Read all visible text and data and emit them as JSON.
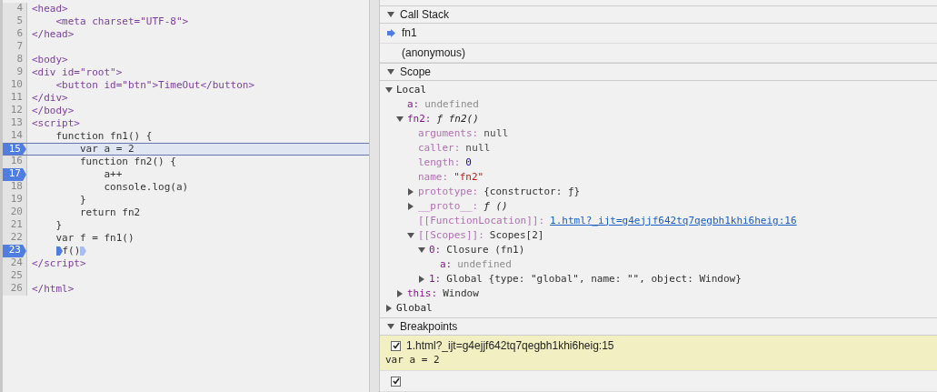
{
  "editor": {
    "lines": [
      {
        "number": "4",
        "code": "<head>",
        "breakpoint": false,
        "current": false
      },
      {
        "number": "5",
        "code": "    <meta charset=\"UTF-8\">",
        "breakpoint": false,
        "current": false
      },
      {
        "number": "6",
        "code": "</head>",
        "breakpoint": false,
        "current": false
      },
      {
        "number": "7",
        "breakpoint": false,
        "current": false
      },
      {
        "number": "8",
        "code": "<body>",
        "breakpoint": false,
        "current": false
      },
      {
        "number": "9",
        "code": "<div id=\"root\">",
        "breakpoint": false,
        "current": false
      },
      {
        "number": "10",
        "code": "    <button id=\"btn\">TimeOut</button>",
        "breakpoint": false,
        "current": false
      },
      {
        "number": "11",
        "code": "</div>",
        "breakpoint": false,
        "current": false
      },
      {
        "number": "12",
        "code": "</body>",
        "breakpoint": false,
        "current": false
      },
      {
        "number": "13",
        "code": "<script>",
        "breakpoint": false,
        "current": false
      },
      {
        "number": "14",
        "code": "    function fn1() {",
        "breakpoint": false,
        "current": false
      },
      {
        "number": "15",
        "code": "        var a = 2",
        "breakpoint": true,
        "current": true
      },
      {
        "number": "16",
        "code": "        function fn2() {",
        "breakpoint": false,
        "current": false
      },
      {
        "number": "17",
        "code": "            a++",
        "breakpoint": true,
        "current": false
      },
      {
        "number": "18",
        "code": "            console.log(a)",
        "breakpoint": false,
        "current": false
      },
      {
        "number": "19",
        "code": "        }",
        "breakpoint": false,
        "current": false
      },
      {
        "number": "20",
        "code": "        return fn2",
        "breakpoint": false,
        "current": false
      },
      {
        "number": "21",
        "code": "    }",
        "breakpoint": false,
        "current": false
      },
      {
        "number": "22",
        "code": "    var f = fn1()",
        "breakpoint": false,
        "current": false
      },
      {
        "number": "23",
        "code": "    f()",
        "breakpoint": true,
        "current": false,
        "inline_markers": true
      },
      {
        "number": "24",
        "code": "</script>",
        "breakpoint": false,
        "current": false
      },
      {
        "number": "25",
        "breakpoint": false,
        "current": false
      },
      {
        "number": "26",
        "code": "</html>",
        "breakpoint": false,
        "current": false
      }
    ]
  },
  "call_stack": {
    "title": "Call Stack",
    "expanded": true,
    "frames": [
      {
        "name": "fn1",
        "selected": true
      },
      {
        "name": "(anonymous)",
        "selected": false
      }
    ]
  },
  "scope": {
    "title": "Scope",
    "expanded": true,
    "tree": [
      {
        "key": "Local",
        "kind": "section",
        "expanded": true,
        "children": [
          {
            "key": "a:",
            "value": "undefined"
          },
          {
            "key": "fn2:",
            "value": "ƒ fn2()",
            "kind": "function",
            "expanded": true,
            "children": [
              {
                "key": "arguments:",
                "value": "null",
                "kind": "null",
                "dim": true
              },
              {
                "key": "caller:",
                "value": "null",
                "kind": "null",
                "dim": true
              },
              {
                "key": "length:",
                "value": "0",
                "kind": "number",
                "dim": true
              },
              {
                "key": "name:",
                "value": "\"fn2\"",
                "kind": "string",
                "dim": true
              },
              {
                "key": "prototype:",
                "value": "{constructor: ƒ}",
                "kind": "object",
                "dim": true,
                "expanded": false
              },
              {
                "key": "__proto__:",
                "value": "ƒ ()",
                "kind": "function",
                "dim": true,
                "expanded": false
              },
              {
                "key": "[[FunctionLocation]]:",
                "value": "1.html?_ijt=g4ejjf642tq7qegbh1khi6heig:16",
                "kind": "link",
                "dim": true
              },
              {
                "key": "[[Scopes]]:",
                "value": "Scopes[2]",
                "kind": "object",
                "dim": true,
                "expanded": true,
                "children": [
                  {
                    "key": "0:",
                    "value": "Closure (fn1)",
                    "kind": "object",
                    "expanded": true,
                    "children": [
                      {
                        "key": "a:",
                        "value": "undefined"
                      }
                    ]
                  },
                  {
                    "key": "1:",
                    "value": "Global {type: \"global\", name: \"\", object: Window}",
                    "kind": "object",
                    "expanded": false
                  }
                ]
              }
            ]
          },
          {
            "key": "this:",
            "value": "Window",
            "kind": "object",
            "expanded": false
          }
        ]
      },
      {
        "key": "Global",
        "kind": "section",
        "expanded": false
      }
    ]
  },
  "breakpoints": {
    "title": "Breakpoints",
    "expanded": true,
    "items": [
      {
        "location": "1.html?_ijt=g4ejjf642tq7qegbh1khi6heig:15",
        "code": "var a = 2",
        "checked": true,
        "selected": true
      },
      {
        "checked": true,
        "selected": false
      }
    ]
  }
}
